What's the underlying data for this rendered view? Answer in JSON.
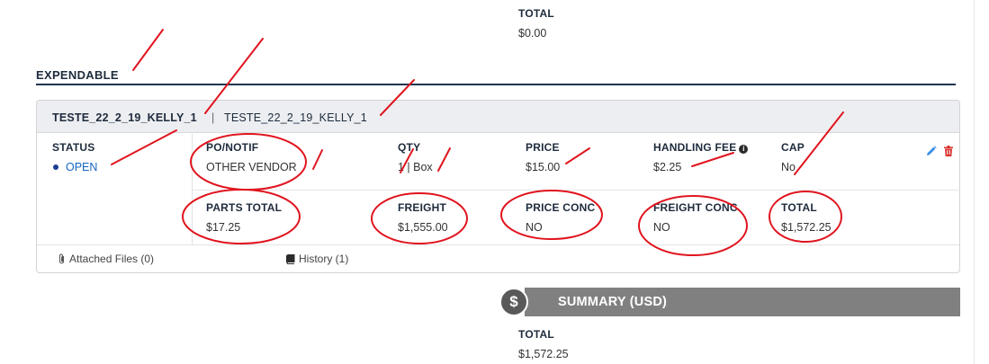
{
  "top_total": {
    "label": "TOTAL",
    "value": "$0.00"
  },
  "section": {
    "title": "EXPENDABLE"
  },
  "card": {
    "header": {
      "name": "TESTE_22_2_19_KELLY_1",
      "separator": "|",
      "name_secondary": "TESTE_22_2_19_KELLY_1"
    },
    "status": {
      "label": "STATUS",
      "value": "OPEN"
    },
    "row1": {
      "po_notif": {
        "label": "PO/NOTIF",
        "value": "OTHER VENDOR"
      },
      "qty": {
        "label": "QTY",
        "value": "1 | Box"
      },
      "price": {
        "label": "PRICE",
        "value": "$15.00"
      },
      "handling_fee": {
        "label": "HANDLING FEE",
        "value": "$2.25"
      },
      "cap": {
        "label": "CAP",
        "value": "No"
      }
    },
    "row2": {
      "parts_total": {
        "label": "PARTS TOTAL",
        "value": "$17.25"
      },
      "freight": {
        "label": "FREIGHT",
        "value": "$1,555.00"
      },
      "price_conc": {
        "label": "PRICE CONC",
        "value": "NO"
      },
      "freight_conc": {
        "label": "FREIGHT CONC",
        "value": "NO"
      },
      "total": {
        "label": "TOTAL",
        "value": "$1,572.25"
      }
    },
    "footer": {
      "attached_files": "Attached Files (0)",
      "history": "History (1)"
    },
    "icons": {
      "edit": "pencil-icon",
      "delete": "trash-icon",
      "info": "info-icon"
    }
  },
  "summary": {
    "icon_symbol": "$",
    "title": "SUMMARY (USD)",
    "total_label": "TOTAL",
    "total_value": "$1,572.25"
  },
  "colors": {
    "navy": "#1e2b3c",
    "status_blue": "#1565c0",
    "edit_blue": "#3a8ee6",
    "delete_red": "#d9302c",
    "annotation_red": "#e0141e",
    "summary_bar": "#808080"
  }
}
